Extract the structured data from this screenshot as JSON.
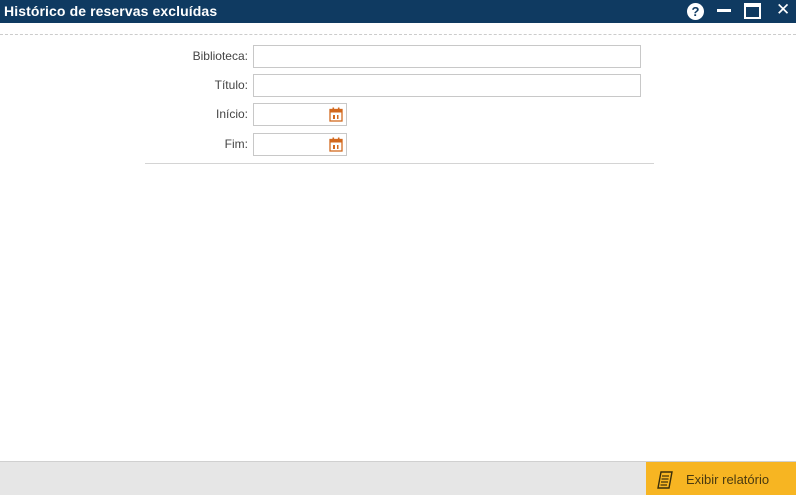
{
  "window": {
    "title": "Histórico de reservas excluídas",
    "help_icon_glyph": "?",
    "close_icon_glyph": "✕"
  },
  "form": {
    "biblioteca_label": "Biblioteca:",
    "biblioteca_value": "",
    "titulo_label": "Título:",
    "titulo_value": "",
    "inicio_label": "Início:",
    "inicio_value": "",
    "fim_label": "Fim:",
    "fim_value": ""
  },
  "footer": {
    "report_button_label": "Exibir relatório"
  },
  "colors": {
    "titlebar": "#0f3a61",
    "accent_button": "#f7b522",
    "calendar_icon": "#d2691e"
  },
  "icons": {
    "help": "help-icon",
    "minimize": "minimize-icon",
    "maximize": "maximize-icon",
    "close": "close-icon",
    "calendar": "calendar-icon",
    "report": "report-icon"
  }
}
